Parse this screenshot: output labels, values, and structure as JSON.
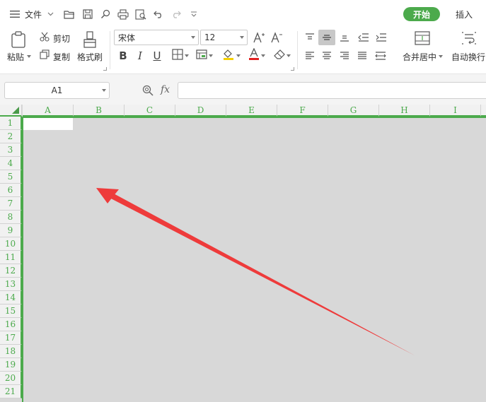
{
  "topbar": {
    "menu_label": "文件",
    "start_tab": "开始",
    "insert_tab": "插入"
  },
  "ribbon": {
    "paste_label": "粘贴",
    "cut_label": "剪切",
    "copy_label": "复制",
    "format_painter_label": "格式刷",
    "font_name": "宋体",
    "font_size": "12",
    "merge_center_label": "合并居中",
    "wrap_text_label": "自动换行",
    "bold": "B",
    "italic": "I",
    "underline": "U"
  },
  "formula_bar": {
    "cell_ref": "A1",
    "fx_label": "fx",
    "formula_value": ""
  },
  "grid": {
    "columns": [
      "A",
      "B",
      "C",
      "D",
      "E",
      "F",
      "G",
      "H",
      "I"
    ],
    "rows": [
      "1",
      "2",
      "3",
      "4",
      "5",
      "6",
      "7",
      "8",
      "9",
      "10",
      "11",
      "12",
      "13",
      "14",
      "15",
      "16",
      "17",
      "18",
      "19",
      "20",
      "21"
    ]
  },
  "colors": {
    "accent_green": "#4caa4c",
    "annotation_red": "#ee3b3b",
    "grid_background": "#d8d8d8"
  }
}
